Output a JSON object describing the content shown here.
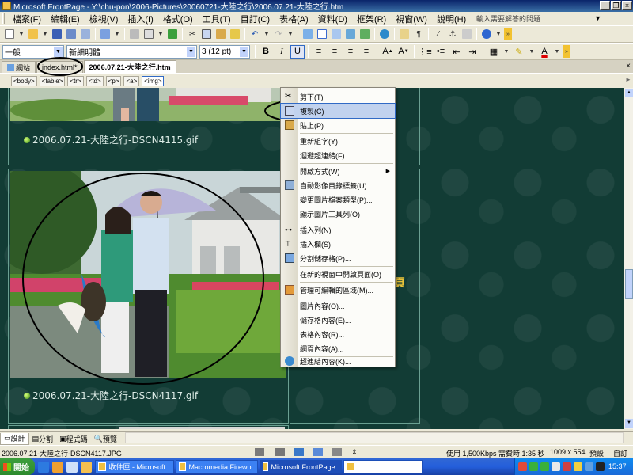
{
  "window": {
    "title": "Microsoft FrontPage - Y:\\chu-pon\\2006-Pictures\\20060721-大陸之行\\2006.07.21-大陸之行.htm"
  },
  "menubar": {
    "items": [
      "檔案(F)",
      "編輯(E)",
      "檢視(V)",
      "插入(I)",
      "格式(O)",
      "工具(T)",
      "目訂(C)",
      "表格(A)",
      "資料(D)",
      "框架(R)",
      "視窗(W)",
      "說明(H)"
    ],
    "help_placeholder": "輸入需要解答的問題"
  },
  "format_toolbar": {
    "style_value": "一般",
    "font_value": "新細明體",
    "size_value": "3 (12 pt)",
    "bold": "B",
    "italic": "I",
    "underline": "U"
  },
  "doc_tabs": {
    "items": [
      "網站",
      "index.html*",
      "2006.07.21-大陸之行.htm"
    ],
    "active_index": 2
  },
  "tag_selector": {
    "tags": [
      "<body>",
      "<table>",
      "<tr>",
      "<td>",
      "<p>",
      "<a>",
      "<img>"
    ],
    "selected": "<img>"
  },
  "page": {
    "caption_top": "2006.07.21-大陸之行-DSCN4115.gif",
    "caption_bottom": "2006.07.21-大陸之行-DSCN4117.gif",
    "right_text": "頁"
  },
  "context_menu": {
    "items": [
      {
        "label": "剪下(T)",
        "icon": "scissors-icon"
      },
      {
        "label": "複製(C)",
        "icon": "copy-icon",
        "highlighted": true
      },
      {
        "label": "貼上(P)",
        "icon": "paste-icon"
      },
      {
        "label": "重新組字(Y)",
        "icon": ""
      },
      {
        "label": "迴避超連結(F)",
        "icon": ""
      },
      {
        "label": "開啟方式(W)",
        "icon": "",
        "submenu": true
      },
      {
        "label": "自動影像目錄標籤(U)",
        "icon": "thumbnail-icon"
      },
      {
        "label": "變更圖片檔案類型(P)...",
        "icon": ""
      },
      {
        "label": "顯示圖片工具列(O)",
        "icon": ""
      },
      {
        "label": "插入列(N)",
        "icon": "insert-row-icon"
      },
      {
        "label": "插入欄(S)",
        "icon": "insert-column-icon"
      },
      {
        "label": "分割儲存格(P)...",
        "icon": "split-cells-icon"
      },
      {
        "label": "在新的視窗中開啟頁面(O)",
        "icon": ""
      },
      {
        "label": "管理可編輯的區域(M)...",
        "icon": "editable-region-icon"
      },
      {
        "label": "圖片內容(O)...",
        "icon": ""
      },
      {
        "label": "儲存格內容(E)...",
        "icon": ""
      },
      {
        "label": "表格內容(R)...",
        "icon": ""
      },
      {
        "label": "網頁內容(A)...",
        "icon": ""
      },
      {
        "label": "超連結內容(K)...",
        "icon": "hyperlink-icon"
      }
    ]
  },
  "view_tabs": [
    "設計",
    "分割",
    "程式碼",
    "預覽"
  ],
  "statusbar": {
    "left": "2006.07.21-大陸之行-DSCN4117.JPG",
    "speed": "使用 1,500Kbps 需費時 1:35 秒",
    "size": "1009 x 554",
    "mode1": "預設",
    "mode2": "自訂"
  },
  "taskbar": {
    "start": "開始",
    "tasks": [
      "收件匣 - Microsoft ...",
      "Macromedia Firewo...",
      "Microsoft FrontPage...",
      ""
    ],
    "clock": "15:37"
  }
}
